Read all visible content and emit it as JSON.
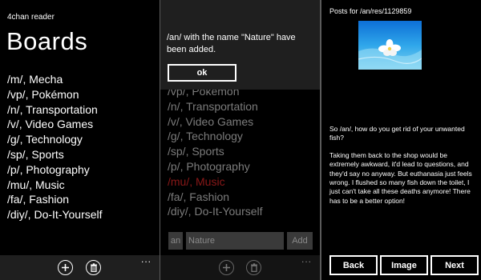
{
  "screen1": {
    "app_title": "4chan reader",
    "page_title": "Boards",
    "boards": [
      "/m/, Mecha",
      "/vp/, Pokémon",
      "/n/, Transportation",
      "/v/, Video Games",
      "/g/, Technology",
      "/sp/, Sports",
      "/p/, Photography",
      "/mu/, Music",
      "/fa/, Fashion",
      "/diy/, Do-It-Yourself"
    ],
    "appbar": {
      "icons": [
        "add-icon",
        "delete-icon"
      ],
      "more": "..."
    }
  },
  "screen2": {
    "dialog": {
      "message": "/an/ with the name \"Nature\" have been added.",
      "ok_label": "ok"
    },
    "boards_visible": [
      "/vp/, Pokémon",
      "/n/, Transportation",
      "/v/, Video Games",
      "/g/, Technology",
      "/sp/, Sports",
      "/p/, Photography",
      "/mu/, Music",
      "/fa/, Fashion",
      "/diy/, Do-It-Yourself"
    ],
    "accent_color": "#8b1818",
    "add_form": {
      "board_code": "an",
      "board_name": "Nature",
      "add_label": "Add"
    },
    "appbar": {
      "icons": [
        "add-icon",
        "delete-icon"
      ],
      "more": "..."
    }
  },
  "screen3": {
    "posts_title": "Posts for /an/res/1129859",
    "paragraphs": [
      "So /an/, how do you get rid of your unwanted fish?",
      "Taking them back to the shop would be extremely awkward, it'd lead to questions, and they'd say no anyway. But euthanasia just feels wrong. I flushed so many fish down the toilet, I just can't take all these deaths anymore! There has to be a better option!"
    ],
    "nav": {
      "back": "Back",
      "image": "Image",
      "next": "Next"
    }
  }
}
